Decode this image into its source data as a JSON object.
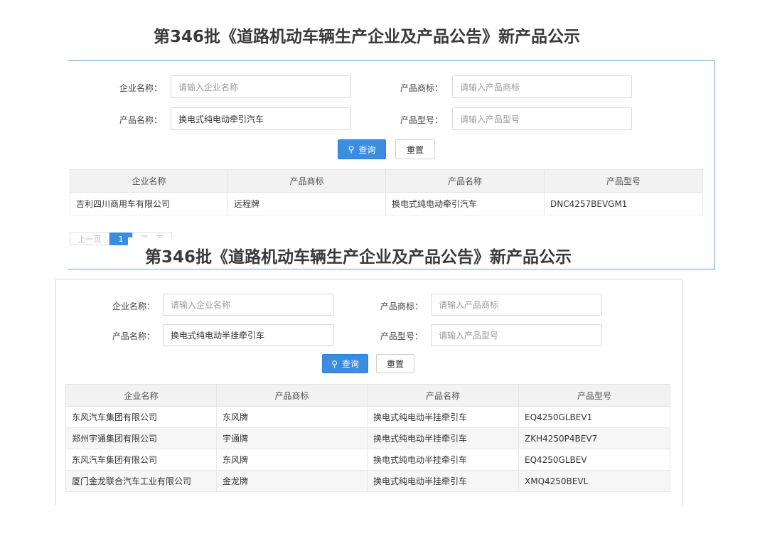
{
  "shot1": {
    "title": "第346批《道路机动车辆生产企业及产品公告》新产品公示",
    "form": {
      "company_label": "企业名称：",
      "company_placeholder": "请输入企业名称",
      "brand_label": "产品商标：",
      "brand_placeholder": "请输入产品商标",
      "product_label": "产品名称：",
      "product_value": "换电式纯电动牵引汽车",
      "model_label": "产品型号：",
      "model_placeholder": "请输入产品型号",
      "search_label": "查询",
      "reset_label": "重置"
    },
    "table": {
      "headers": [
        "企业名称",
        "产品商标",
        "产品名称",
        "产品型号"
      ],
      "rows": [
        [
          "吉利四川商用车有限公司",
          "远程牌",
          "换电式纯电动牵引汽车",
          "DNC4257BEVGM1"
        ]
      ]
    },
    "pager": {
      "prev": "上一页",
      "current": "1",
      "next": "下一页"
    }
  },
  "shot2": {
    "title": "第346批《道路机动车辆生产企业及产品公告》新产品公示",
    "form": {
      "company_label": "企业名称：",
      "company_placeholder": "请输入企业名称",
      "brand_label": "产品商标：",
      "brand_placeholder": "请输入产品商标",
      "product_label": "产品名称：",
      "product_value": "换电式纯电动半挂牵引车",
      "model_label": "产品型号：",
      "model_placeholder": "请输入产品型号",
      "search_label": "查询",
      "reset_label": "重置"
    },
    "table": {
      "headers": [
        "企业名称",
        "产品商标",
        "产品名称",
        "产品型号"
      ],
      "rows": [
        [
          "东风汽车集团有限公司",
          "东风牌",
          "换电式纯电动半挂牵引车",
          "EQ4250GLBEV1"
        ],
        [
          "郑州宇通集团有限公司",
          "宇通牌",
          "换电式纯电动半挂牵引车",
          "ZKH4250P4BEV7"
        ],
        [
          "东风汽车集团有限公司",
          "东风牌",
          "换电式纯电动半挂牵引车",
          "EQ4250GLBEV"
        ],
        [
          "厦门金龙联合汽车工业有限公司",
          "金龙牌",
          "换电式纯电动半挂牵引车",
          "XMQ4250BEVL"
        ]
      ]
    }
  },
  "colors": {
    "accent": "#3b8de0",
    "panel_border": "#6ea3d6",
    "header_bg": "#f2f2f2"
  },
  "icons": {
    "search": "search-icon"
  }
}
